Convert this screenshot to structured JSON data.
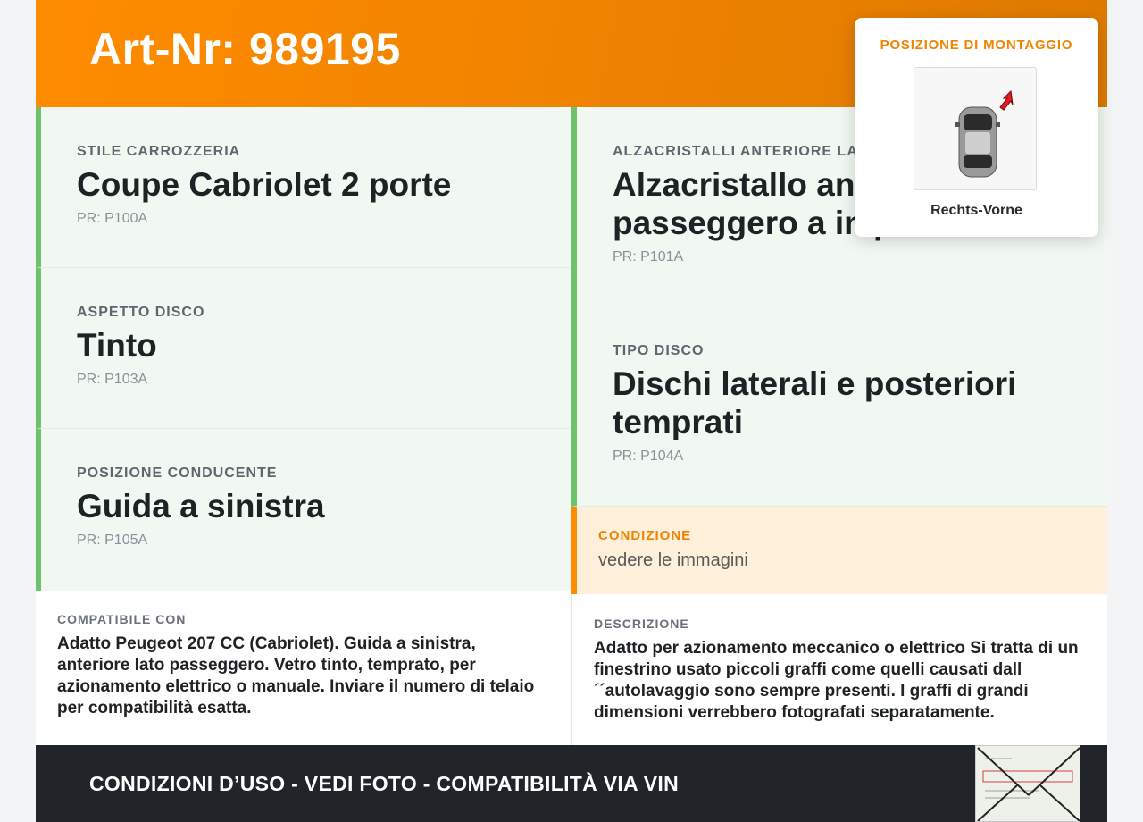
{
  "header": {
    "title": "Art-Nr: 989195"
  },
  "specs_left": [
    {
      "label": "STILE CARROZZERIA",
      "value": "Coupe Cabriolet 2 porte",
      "pr": "PR: P100A"
    },
    {
      "label": "ASPETTO DISCO",
      "value": "Tinto",
      "pr": "PR: P103A"
    },
    {
      "label": "POSIZIONE CONDUCENTE",
      "value": "Guida a sinistra",
      "pr": "PR: P105A"
    }
  ],
  "specs_right": [
    {
      "label": "ALZACRISTALLI ANTERIORE LATO PASSEGGERO",
      "value": "Alzacristallo anteriore lato passeggero a impulsi",
      "pr": "PR: P101A"
    },
    {
      "label": "TIPO DISCO",
      "value": "Dischi laterali e posteriori temprati",
      "pr": "PR: P104A"
    }
  ],
  "condition": {
    "label": "CONDIZIONE",
    "value": "vedere le immagini"
  },
  "compatible": {
    "label": "COMPATIBILE CON",
    "text": "Adatto Peugeot 207 CC (Cabriolet). Guida a sinistra, anteriore lato passeggero. Vetro tinto, temprato, per azionamento elettrico o manuale. Inviare il numero di telaio per compatibilità esatta."
  },
  "description": {
    "label": "DESCRIZIONE",
    "text": "Adatto per azionamento meccanico o elettrico Si tratta di un finestrino usato piccoli graffi come quelli causati dall ´´autolavaggio sono sempre presenti. I graffi di grandi dimensioni verrebbero fotografati separatamente."
  },
  "footer": {
    "text": "CONDIZIONI D’USO - VEDI FOTO - COMPATIBILITÀ VIA VIN"
  },
  "mount_popup": {
    "title": "POSIZIONE DI MONTAGGIO",
    "caption": "Rechts-Vorne"
  },
  "colors": {
    "orange": "#ff8c00",
    "green": "#6cc36c",
    "dark": "#212529"
  }
}
